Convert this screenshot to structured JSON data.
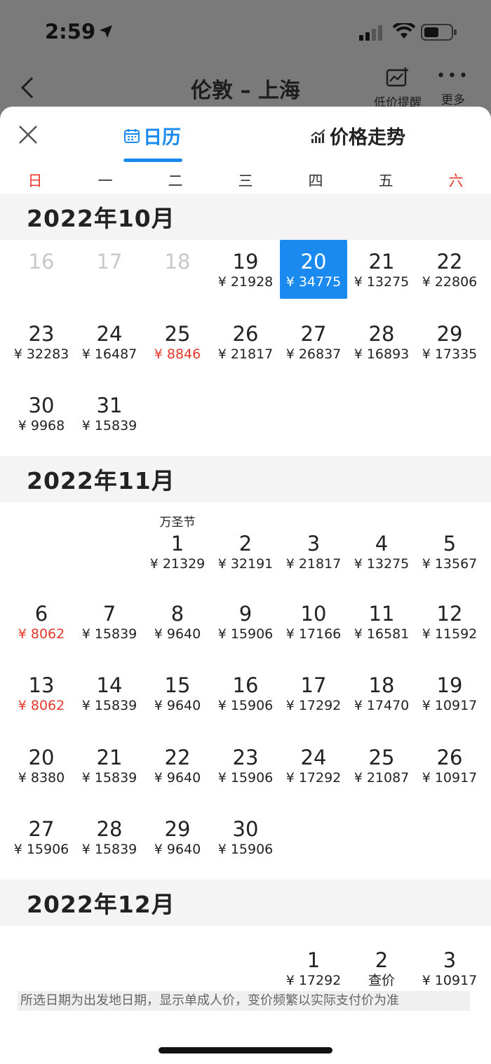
{
  "status_bar": {
    "time": "2:59"
  },
  "nav": {
    "route": "伦敦 – 上海",
    "price_alert_label": "低价提醒",
    "more_label": "更多"
  },
  "tabs": {
    "calendar": "日历",
    "trend": "价格走势"
  },
  "weekdays": [
    "日",
    "一",
    "二",
    "三",
    "四",
    "五",
    "六"
  ],
  "colors": {
    "accent": "#1a8af0",
    "low_price": "#e8372c",
    "weekend": "#e8372c"
  },
  "months": [
    {
      "title": "2022年10月",
      "weeks": [
        [
          null,
          null,
          null,
          null,
          null,
          null,
          null
        ],
        [
          {
            "day": "16",
            "disabled": true
          },
          {
            "day": "17",
            "disabled": true
          },
          {
            "day": "18",
            "disabled": true
          },
          {
            "day": "19",
            "price": "¥ 21928"
          },
          {
            "day": "20",
            "price": "¥ 34775",
            "selected": true
          },
          {
            "day": "21",
            "price": "¥ 13275"
          },
          {
            "day": "22",
            "price": "¥ 22806"
          }
        ],
        [
          {
            "day": "23",
            "price": "¥ 32283"
          },
          {
            "day": "24",
            "price": "¥ 16487"
          },
          {
            "day": "25",
            "price": "¥ 8846",
            "low": true
          },
          {
            "day": "26",
            "price": "¥ 21817"
          },
          {
            "day": "27",
            "price": "¥ 26837"
          },
          {
            "day": "28",
            "price": "¥ 16893"
          },
          {
            "day": "29",
            "price": "¥ 17335"
          }
        ],
        [
          {
            "day": "30",
            "price": "¥ 9968"
          },
          {
            "day": "31",
            "price": "¥ 15839"
          },
          null,
          null,
          null,
          null,
          null
        ]
      ]
    },
    {
      "title": "2022年11月",
      "weeks": [
        [
          null,
          null,
          {
            "day": "1",
            "price": "¥ 21329",
            "holiday": "万圣节"
          },
          {
            "day": "2",
            "price": "¥ 32191"
          },
          {
            "day": "3",
            "price": "¥ 21817"
          },
          {
            "day": "4",
            "price": "¥ 13275"
          },
          {
            "day": "5",
            "price": "¥ 13567"
          }
        ],
        [
          {
            "day": "6",
            "price": "¥ 8062",
            "low": true
          },
          {
            "day": "7",
            "price": "¥ 15839"
          },
          {
            "day": "8",
            "price": "¥ 9640"
          },
          {
            "day": "9",
            "price": "¥ 15906"
          },
          {
            "day": "10",
            "price": "¥ 17166"
          },
          {
            "day": "11",
            "price": "¥ 16581"
          },
          {
            "day": "12",
            "price": "¥ 11592"
          }
        ],
        [
          {
            "day": "13",
            "price": "¥ 8062",
            "low": true
          },
          {
            "day": "14",
            "price": "¥ 15839"
          },
          {
            "day": "15",
            "price": "¥ 9640"
          },
          {
            "day": "16",
            "price": "¥ 15906"
          },
          {
            "day": "17",
            "price": "¥ 17292"
          },
          {
            "day": "18",
            "price": "¥ 17470"
          },
          {
            "day": "19",
            "price": "¥ 10917"
          }
        ],
        [
          {
            "day": "20",
            "price": "¥ 8380"
          },
          {
            "day": "21",
            "price": "¥ 15839"
          },
          {
            "day": "22",
            "price": "¥ 9640"
          },
          {
            "day": "23",
            "price": "¥ 15906"
          },
          {
            "day": "24",
            "price": "¥ 17292"
          },
          {
            "day": "25",
            "price": "¥ 21087"
          },
          {
            "day": "26",
            "price": "¥ 10917"
          }
        ],
        [
          {
            "day": "27",
            "price": "¥ 15906"
          },
          {
            "day": "28",
            "price": "¥ 15839"
          },
          {
            "day": "29",
            "price": "¥ 9640"
          },
          {
            "day": "30",
            "price": "¥ 15906"
          },
          null,
          null,
          null
        ]
      ]
    },
    {
      "title": "2022年12月",
      "weeks": [
        [
          null,
          null,
          null,
          null,
          {
            "day": "1",
            "price": "¥ 17292"
          },
          {
            "day": "2",
            "price": "查价"
          },
          {
            "day": "3",
            "price": "¥ 10917"
          }
        ]
      ]
    }
  ],
  "footer_note": "所选日期为出发地日期，显示单成人价，变价频繁以实际支付价为准"
}
